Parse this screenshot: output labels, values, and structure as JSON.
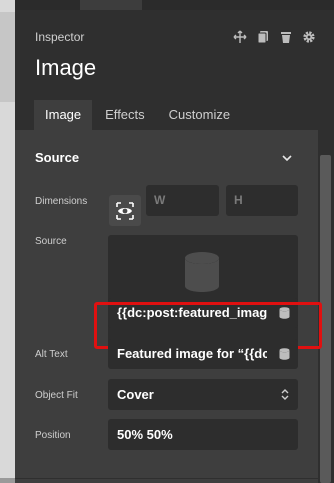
{
  "inspector": {
    "label": "Inspector",
    "title": "Image"
  },
  "toolbar_icons": [
    "move-icon",
    "duplicate-icon",
    "delete-icon",
    "settings-icon"
  ],
  "tabs": [
    {
      "label": "Image",
      "active": true
    },
    {
      "label": "Effects",
      "active": false
    },
    {
      "label": "Customize",
      "active": false
    }
  ],
  "section": {
    "title": "Source",
    "expanded": true
  },
  "dimensions": {
    "label": "Dimensions",
    "width_placeholder": "W",
    "height_placeholder": "H"
  },
  "source": {
    "label": "Source",
    "value": "{{dc:post:featured_image_"
  },
  "alt_text": {
    "label": "Alt Text",
    "value": "Featured image for “{{dc:p"
  },
  "object_fit": {
    "label": "Object Fit",
    "value": "Cover"
  },
  "position": {
    "label": "Position",
    "value": "50% 50%"
  },
  "colors": {
    "panel": "#2f2f2f",
    "content": "#3e3e3e",
    "field": "#2d2d2d",
    "highlight": "#e01010"
  }
}
